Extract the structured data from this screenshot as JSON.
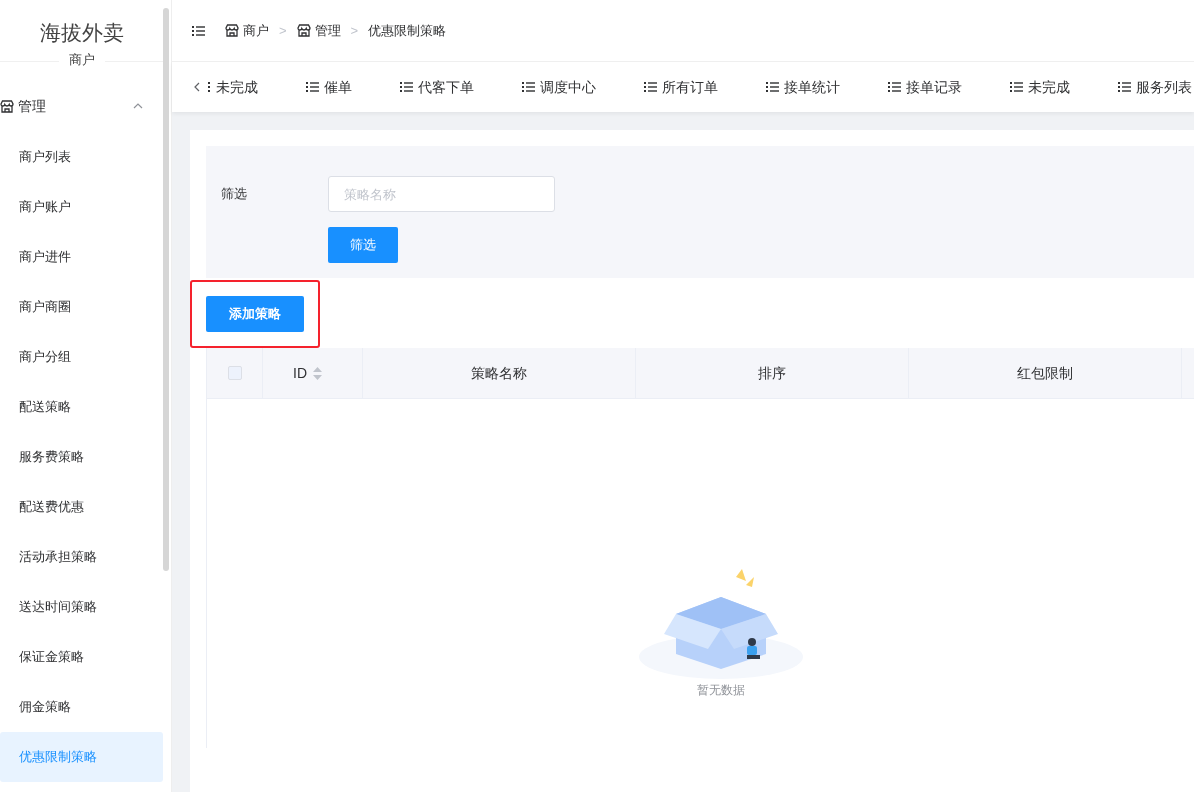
{
  "sidebar": {
    "title": "海拔外卖",
    "subtitle": "商户",
    "group": {
      "label": "管理",
      "expanded": true
    },
    "items": [
      {
        "label": "商户列表",
        "selected": false
      },
      {
        "label": "商户账户",
        "selected": false
      },
      {
        "label": "商户进件",
        "selected": false
      },
      {
        "label": "商户商圈",
        "selected": false
      },
      {
        "label": "商户分组",
        "selected": false
      },
      {
        "label": "配送策略",
        "selected": false
      },
      {
        "label": "服务费策略",
        "selected": false
      },
      {
        "label": "配送费优惠",
        "selected": false
      },
      {
        "label": "活动承担策略",
        "selected": false
      },
      {
        "label": "送达时间策略",
        "selected": false
      },
      {
        "label": "保证金策略",
        "selected": false
      },
      {
        "label": "佣金策略",
        "selected": false
      },
      {
        "label": "优惠限制策略",
        "selected": true
      }
    ]
  },
  "breadcrumb": [
    {
      "label": "商户",
      "kind": "store"
    },
    {
      "label": "管理",
      "kind": "store"
    },
    {
      "label": "优惠限制策略",
      "kind": "plain"
    }
  ],
  "breadcrumb_separator": ">",
  "tabs": [
    {
      "label": "未完成",
      "kind": "cut"
    },
    {
      "label": "催单",
      "kind": "full"
    },
    {
      "label": "代客下单",
      "kind": "full"
    },
    {
      "label": "调度中心",
      "kind": "full"
    },
    {
      "label": "所有订单",
      "kind": "full"
    },
    {
      "label": "接单统计",
      "kind": "full"
    },
    {
      "label": "接单记录",
      "kind": "full"
    },
    {
      "label": "未完成",
      "kind": "full"
    },
    {
      "label": "服务列表",
      "kind": "full"
    }
  ],
  "filter": {
    "label": "筛选",
    "placeholder": "策略名称",
    "button": "筛选"
  },
  "add_button": {
    "label": "添加策略",
    "highlighted": true
  },
  "table": {
    "columns": [
      {
        "label": "ID",
        "sortable": true
      },
      {
        "label": "策略名称",
        "sortable": false
      },
      {
        "label": "排序",
        "sortable": false
      },
      {
        "label": "红包限制",
        "sortable": false
      }
    ],
    "select_all": {
      "checked": false
    },
    "empty_text": "暂无数据"
  }
}
